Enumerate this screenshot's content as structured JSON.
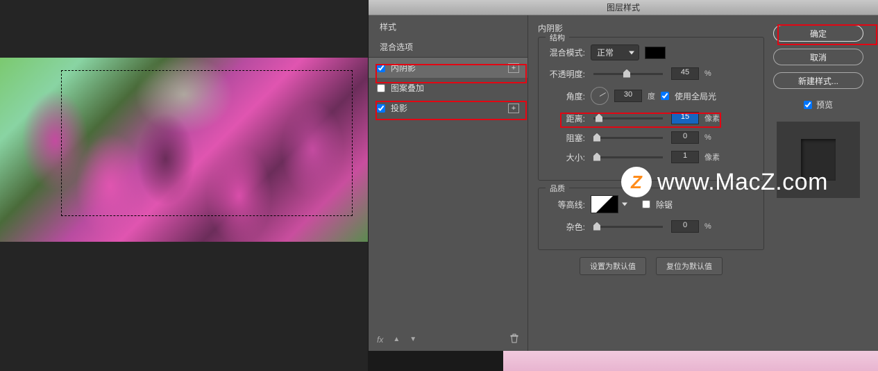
{
  "dialog_title": "图层样式",
  "styles": {
    "header": "样式",
    "blending_options": "混合选项",
    "items": [
      {
        "label": "内阴影",
        "checked": true,
        "selected": true,
        "has_add": true
      },
      {
        "label": "图案叠加",
        "checked": false,
        "selected": false,
        "has_add": false
      },
      {
        "label": "投影",
        "checked": true,
        "selected": false,
        "has_add": true
      }
    ],
    "fx_label": "fx"
  },
  "settings": {
    "title": "内阴影",
    "structure_legend": "结构",
    "blend_mode_label": "混合模式:",
    "blend_mode_value": "正常",
    "opacity_label": "不透明度:",
    "opacity_value": "45",
    "opacity_unit": "%",
    "angle_label": "角度:",
    "angle_value": "30",
    "angle_unit": "度",
    "global_light_label": "使用全局光",
    "distance_label": "距离:",
    "distance_value": "15",
    "distance_unit": "像素",
    "choke_label": "阻塞:",
    "choke_value": "0",
    "choke_unit": "%",
    "size_label": "大小:",
    "size_value": "1",
    "size_unit": "像素",
    "quality_legend": "品质",
    "contour_label": "等高线:",
    "antialias_label": "除锯",
    "noise_label": "杂色:",
    "noise_value": "0",
    "noise_unit": "%",
    "set_default": "设置为默认值",
    "reset_default": "复位为默认值"
  },
  "buttons": {
    "ok": "确定",
    "cancel": "取消",
    "new_style": "新建样式...",
    "preview": "预览"
  },
  "watermark": {
    "badge": "Z",
    "text": "www.MacZ.com"
  }
}
